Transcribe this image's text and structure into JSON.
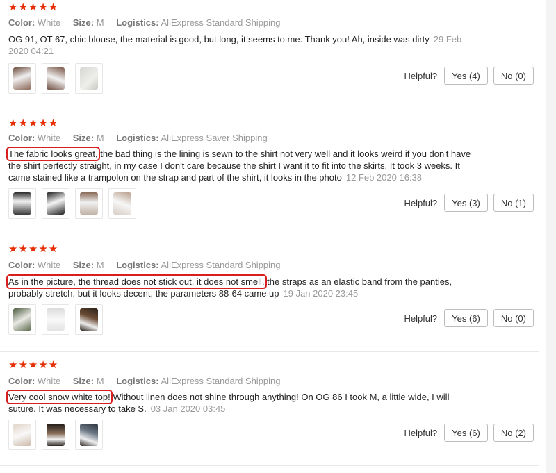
{
  "labels": {
    "color": "Color:",
    "size": "Size:",
    "logistics": "Logistics:",
    "helpful": "Helpful?"
  },
  "reviews": [
    {
      "stars": "★★★★★",
      "color": "White",
      "size": "M",
      "logistics": "AliExpress Standard Shipping",
      "highlight": "",
      "text": "OG 91, OT 67, chic blouse, the material is good, but long, it seems to me. Thank you! Ah, inside was dirty",
      "date": "29 Feb 2020 04:21",
      "yes": "Yes (4)",
      "no": "No (0)",
      "photos": [
        "photo-1",
        "photo-2",
        "photo-3"
      ]
    },
    {
      "stars": "★★★★★",
      "color": "White",
      "size": "M",
      "logistics": "AliExpress Saver Shipping",
      "highlight": "The fabric looks great,",
      "text": " the bad thing is the lining is sewn to the shirt not very well and it looks weird if you don't have the shirt perfectly straight, in my case I don't care because the shirt I want it to fit into the skirts. It took 3 weeks. It came stained like a trampolon on the strap and part of the shirt, it looks in the photo",
      "date": "12 Feb 2020 16:38",
      "yes": "Yes (3)",
      "no": "No (1)",
      "photos": [
        "photo-1",
        "photo-2",
        "photo-3",
        "photo-4"
      ]
    },
    {
      "stars": "★★★★★",
      "color": "White",
      "size": "M",
      "logistics": "AliExpress Standard Shipping",
      "highlight": "As in the picture, the thread does not stick out, it does not smell,",
      "text": " the straps as an elastic band from the panties, probably stretch, but it looks decent, the parameters 88-64 came up",
      "date": "19 Jan 2020 23:45",
      "yes": "Yes (6)",
      "no": "No (0)",
      "photos": [
        "photo-1",
        "photo-2",
        "photo-3"
      ]
    },
    {
      "stars": "★★★★★",
      "color": "White",
      "size": "M",
      "logistics": "AliExpress Standard Shipping",
      "highlight": "Very cool snow white top!",
      "text": " Without linen does not shine through anything! On OG 86 I took M, a little wide, I will suture. It was necessary to take S.",
      "date": "03 Jan 2020 03:45",
      "yes": "Yes (6)",
      "no": "No (2)",
      "photos": [
        "photo-1",
        "photo-2",
        "photo-3"
      ]
    }
  ],
  "colors": {
    "star": "#e62e04",
    "highlight_border": "#d91e1e"
  }
}
